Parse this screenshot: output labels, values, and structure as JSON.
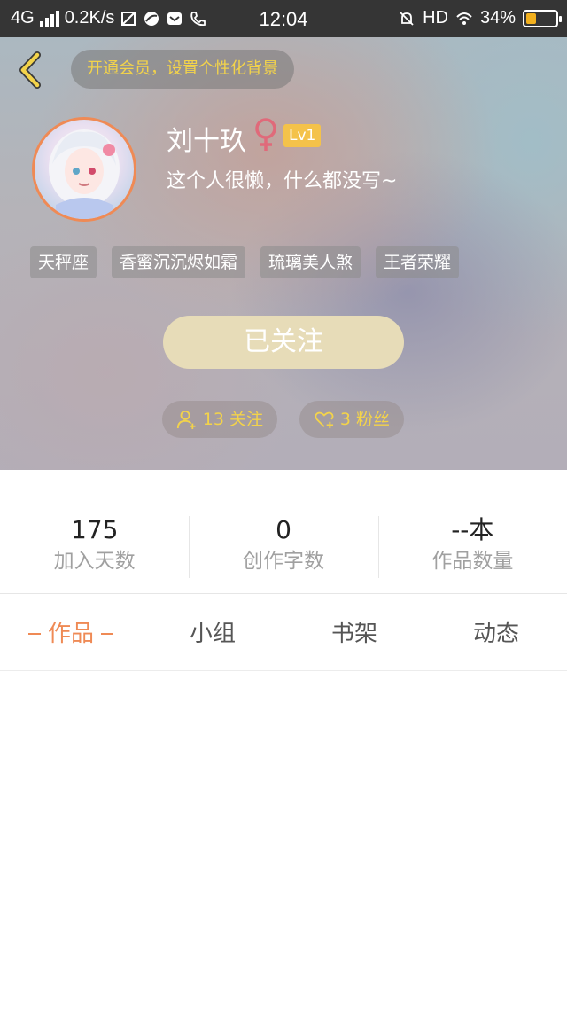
{
  "status_bar": {
    "network": "4G",
    "speed": "0.2K/s",
    "time": "12:04",
    "hd": "HD",
    "battery_percent": "34%",
    "battery_level": 0.34,
    "battery_color": "#f2b01e"
  },
  "header": {
    "back_icon": "chevron-left-icon",
    "vip_banner": "开通会员，设置个性化背景",
    "nickname": "刘十玖",
    "gender_icon": "female-icon",
    "level": "Lv1",
    "bio": "这个人很懒，什么都没写~",
    "tags": [
      "天秤座",
      "香蜜沉沉烬如霜",
      "琉璃美人煞",
      "王者荣耀"
    ],
    "follow_button": "已关注",
    "following": "13 关注",
    "fans": "3 粉丝"
  },
  "stats": [
    {
      "value": "175",
      "label": "加入天数"
    },
    {
      "value": "0",
      "label": "创作字数"
    },
    {
      "value": "--本",
      "label": "作品数量"
    }
  ],
  "tabs": [
    "作品",
    "小组",
    "书架",
    "动态"
  ],
  "active_tab": 0,
  "colors": {
    "accent": "#ef8a55",
    "gold": "#f3d34a",
    "level_badge": "#f4c24a",
    "follow_button": "#e7dcb8"
  }
}
